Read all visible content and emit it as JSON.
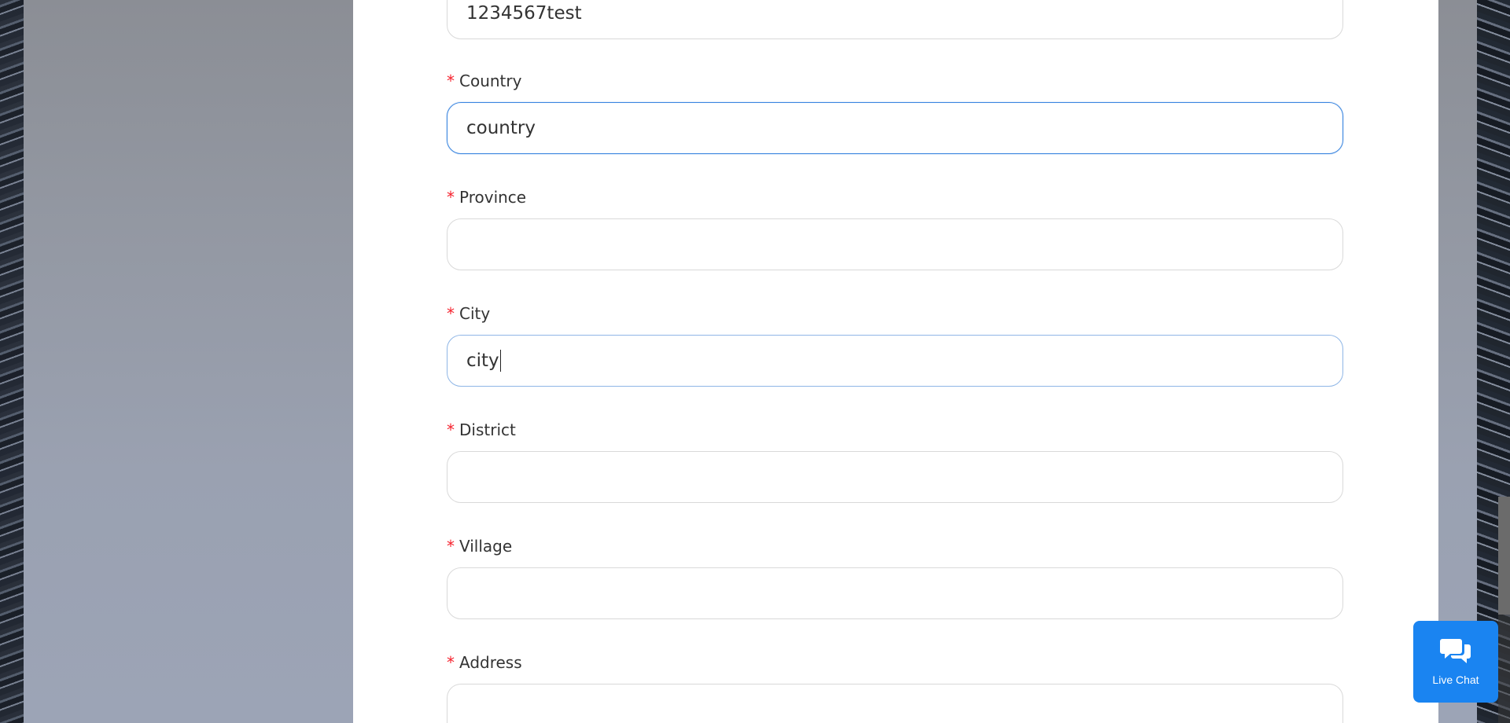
{
  "form": {
    "password_value": "1234567test",
    "fields": [
      {
        "label": "Country",
        "value": "country",
        "required_mark": "*"
      },
      {
        "label": "Province",
        "value": "",
        "required_mark": "*"
      },
      {
        "label": "City",
        "value": "city",
        "required_mark": "*"
      },
      {
        "label": "District",
        "value": "",
        "required_mark": "*"
      },
      {
        "label": "Village",
        "value": "",
        "required_mark": "*"
      },
      {
        "label": "Address",
        "value": "",
        "required_mark": "*"
      }
    ]
  },
  "chat_widget": {
    "label": "Live Chat",
    "icon": "chat-bubbles-icon"
  },
  "colors": {
    "accent": "#1a84f1",
    "focus_border": "#3b86e0",
    "required": "#f5222d"
  }
}
